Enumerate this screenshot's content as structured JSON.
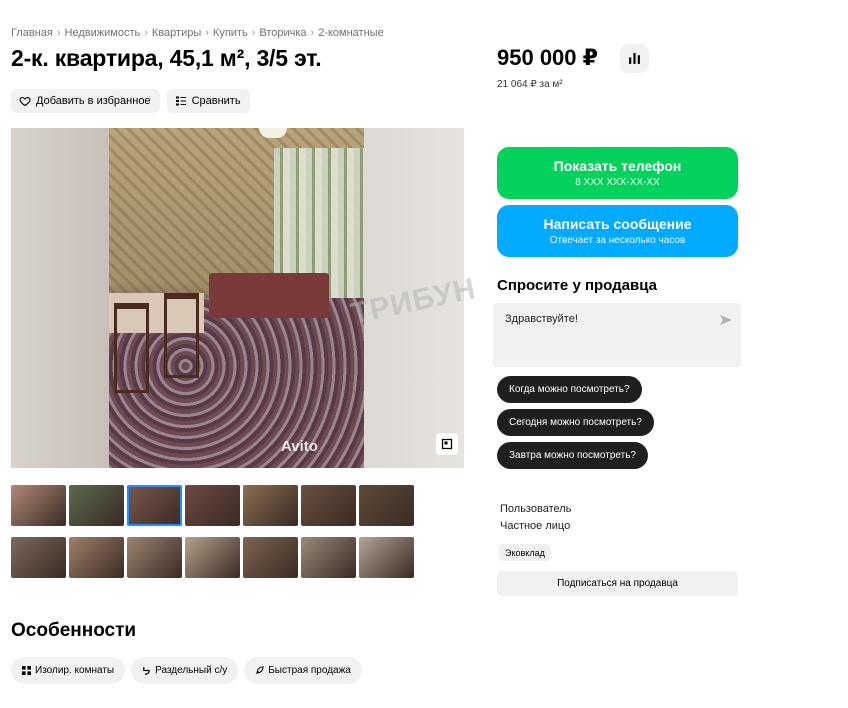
{
  "breadcrumb": [
    "Главная",
    "Недвижимость",
    "Квартиры",
    "Купить",
    "Вторичка",
    "2-комнатные"
  ],
  "breadcrumb_separator": "›",
  "title": "2-к. квартира, 45,1 м², 3/5 эт.",
  "actions": {
    "favorite_label": "Добавить в избранное",
    "compare_label": "Сравнить"
  },
  "photo": {
    "watermark": "Avito",
    "stamp": "ТРИБУН"
  },
  "thumbnails": {
    "colors": [
      "#b08978",
      "#5b6b4e",
      "#7a5a4e",
      "#6e4a44",
      "#8a6f52",
      "#6b5040",
      "#5d4b38",
      "#7d6a5c",
      "#a08068",
      "#9c8470",
      "#b5a18a",
      "#7e6551",
      "#9a8a77",
      "#b4a494"
    ],
    "active_index": 2
  },
  "features": {
    "title": "Особенности",
    "tags": [
      {
        "icon": "grid-icon",
        "label": "Изолир. комнаты"
      },
      {
        "icon": "toilet-icon",
        "label": "Раздельный с/у"
      },
      {
        "icon": "rocket-icon",
        "label": "Быстрая продажа"
      }
    ]
  },
  "price": {
    "value": "950 000 ₽",
    "per_meter": "21 064 ₽ за м²"
  },
  "contact": {
    "show_phone_label": "Показать телефон",
    "phone_mask": "8 XXX XXX-XX-XX",
    "message_label": "Написать сообщение",
    "message_sub": "Отвечает за несколько часов"
  },
  "ask": {
    "title": "Спросите у продавца",
    "message_text": "Здравствуйте!",
    "quick_replies": [
      "Когда можно посмотреть?",
      "Сегодня можно посмотреть?",
      "Завтра можно посмотреть?"
    ]
  },
  "seller": {
    "type": "Пользователь",
    "name": "Частное лицо",
    "badge": "Эковклад",
    "subscribe_label": "Подписаться на продавца"
  },
  "colors": {
    "green": "#02d15c",
    "blue": "#00aaff",
    "chip_bg": "#f2f1f0",
    "quick_bg": "#1f1f1f"
  }
}
